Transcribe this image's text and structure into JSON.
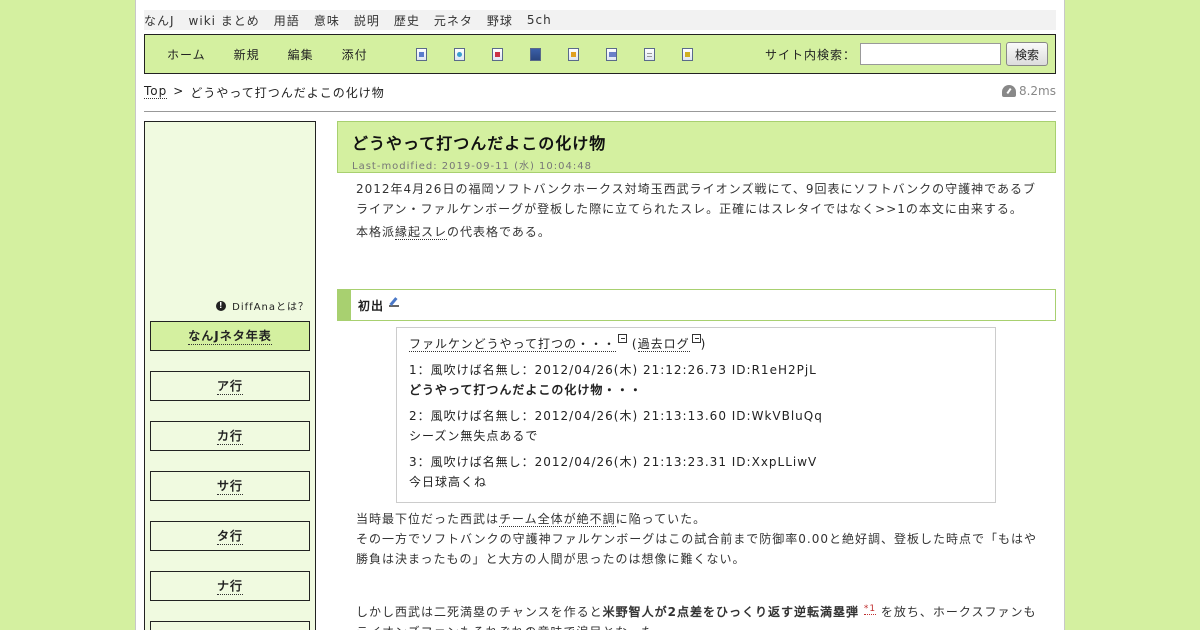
{
  "topnav": [
    "なんJ",
    "wiki まとめ",
    "用語",
    "意味",
    "説明",
    "歴史",
    "元ネタ",
    "野球",
    "5ch"
  ],
  "toolbar": {
    "menu": [
      "ホーム",
      "新規",
      "編集",
      "添付"
    ],
    "icons": [
      "new-page-icon",
      "search-page-icon",
      "diff-icon",
      "save-icon",
      "lock-icon",
      "copy-icon",
      "list-icon",
      "help-icon"
    ],
    "search_label": "サイト内検索：",
    "search_placeholder": "",
    "search_button": "検索"
  },
  "breadcrumb": {
    "top": "Top",
    "sep": ">",
    "current": "どうやって打つんだよこの化け物"
  },
  "timing": "8.2ms",
  "sidebar": {
    "diffana": "DiffAnaとは？",
    "items": [
      "なんJネタ年表",
      "ア行",
      "カ行",
      "サ行",
      "タ行",
      "ナ行"
    ]
  },
  "article": {
    "title": "どうやって打つんだよこの化け物",
    "modified": "Last-modified: 2019-09-11 (水) 10:04:48",
    "intro1": "2012年4月26日の福岡ソフトバンクホークス対埼玉西武ライオンズ戦にて、9回表にソフトバンクの守護神であるブライアン・ファルケンボーグが登板した際に立てられたスレ。正確にはスレタイではなく>>1の本文に由来する。",
    "intro2_a": "本格派",
    "intro2_b": "縁起スレ",
    "intro2_c": "の代表格である。",
    "section": "初出",
    "quote": {
      "link": "ファルケンどうやって打つの・・・",
      "open": "(",
      "log": "過去ログ",
      "close": ")",
      "posts": [
        {
          "head": "1：風吹けば名無し：2012/04/26(木) 21:12:26.73 ID:R1eH2PjL",
          "body": "どうやって打つんだよこの化け物・・・"
        },
        {
          "head": "2：風吹けば名無し：2012/04/26(木) 21:13:13.60 ID:WkVBluQq",
          "body": "シーズン無失点あるで"
        },
        {
          "head": "3：風吹けば名無し：2012/04/26(木) 21:13:23.31 ID:XxpLLiwV",
          "body": "今日球高くね"
        }
      ]
    },
    "p3_a": "当時最下位だった西武は",
    "p3_b": "チーム全体が絶不調",
    "p3_c": "に陥っていた。",
    "p4": "その一方でソフトバンクの守護神ファルケンボーグはこの試合前まで防御率0.00と絶好調、登板した時点で「もはや勝負は決まったもの」と大方の人間が思ったのは想像に難くない。",
    "p5_a": "しかし西武は二死満塁のチャンスを作ると",
    "p5_b": "米野智人が2点差をひっくり返す逆転満塁弾",
    "p5_ref": "*1",
    "p5_c": "を放ち、ホークスファンもライオンズファンもそれぞれの意味で涙目となった。"
  }
}
